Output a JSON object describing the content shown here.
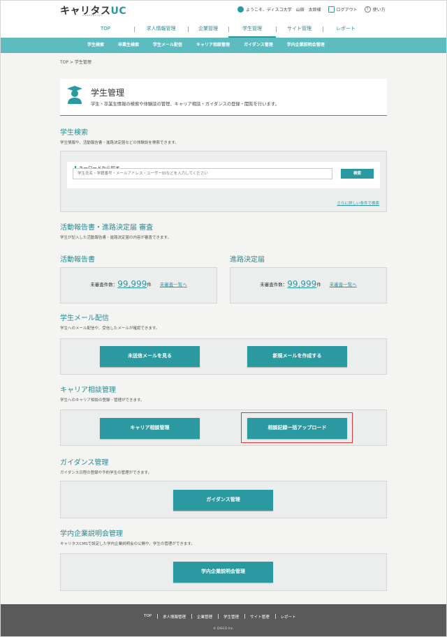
{
  "header": {
    "logo_main": "キャリタス",
    "logo_uc": "UC",
    "logo_sub": "CAREERTASU",
    "welcome": "ようこそ、ディスコ大学　山田　太郎様",
    "logout": "ログアウト",
    "help": "使い方"
  },
  "mainnav": [
    "TOP",
    "求人情報管理",
    "企業管理",
    "学生管理",
    "サイト管理",
    "レポート"
  ],
  "subnav": [
    "学生検索",
    "卒業生検索",
    "学生メール配信",
    "キャリア相談管理",
    "ガイダンス管理",
    "学内企業説明会管理"
  ],
  "breadcrumb": "TOP > 学生管理",
  "page": {
    "title": "学生管理",
    "desc": "学生・卒業生情報の検索や体験談の管理、キャリア相談・ガイダンスの登録・閲覧を行います。"
  },
  "search": {
    "heading": "学生検索",
    "desc": "学生情報や、活動報告書・進路決定届などの体験談を検索できます。",
    "kw_label": "キーワードから探す",
    "placeholder": "学生氏名・学籍番号・メールアドレス・ユーザーIDなどを入力してください",
    "button": "検索",
    "detail_link": "さらに詳しい条件で検索"
  },
  "review": {
    "heading": "活動報告書・進路決定届 審査",
    "desc": "学生が記入した活動報告書・進路決定届の内容が審査できます。",
    "activity": {
      "heading": "活動報告書",
      "label": "未審査件数：",
      "count": "99,999",
      "unit": "件",
      "link": "未審査一覧へ"
    },
    "career": {
      "heading": "進路決定届",
      "label": "未審査件数：",
      "count": "99,999",
      "unit": "件",
      "link": "未審査一覧へ"
    }
  },
  "mail": {
    "heading": "学生メール配信",
    "desc": "学生へのメール配信や、受信したメールが確認できます。",
    "btn_unsent": "未送信メールを見る",
    "btn_new": "新規メールを作成する"
  },
  "consult": {
    "heading": "キャリア相談管理",
    "desc": "学生へのキャリア相談の登録・管理ができます。",
    "btn_manage": "キャリア相談管理",
    "btn_upload": "相談記録一括アップロード"
  },
  "guidance": {
    "heading": "ガイダンス管理",
    "desc": "ガイダンス日程の登録や予約学生の管理ができます。",
    "btn": "ガイダンス管理"
  },
  "briefing": {
    "heading": "学内企業説明会管理",
    "desc": "キャリタスCMSで設定した学内企業説明会の公開や、学生の管理ができます。",
    "btn": "学内企業説明会管理"
  },
  "footer": {
    "links": [
      "TOP",
      "求人情報管理",
      "企業管理",
      "学生管理",
      "サイト管理",
      "レポート"
    ],
    "copyright": "© DISCO Inc."
  },
  "colors": {
    "accent": "#2a9aa0",
    "subnav": "#5cbcc0",
    "highlight": "#d9383a",
    "footer": "#5a5a5a"
  }
}
